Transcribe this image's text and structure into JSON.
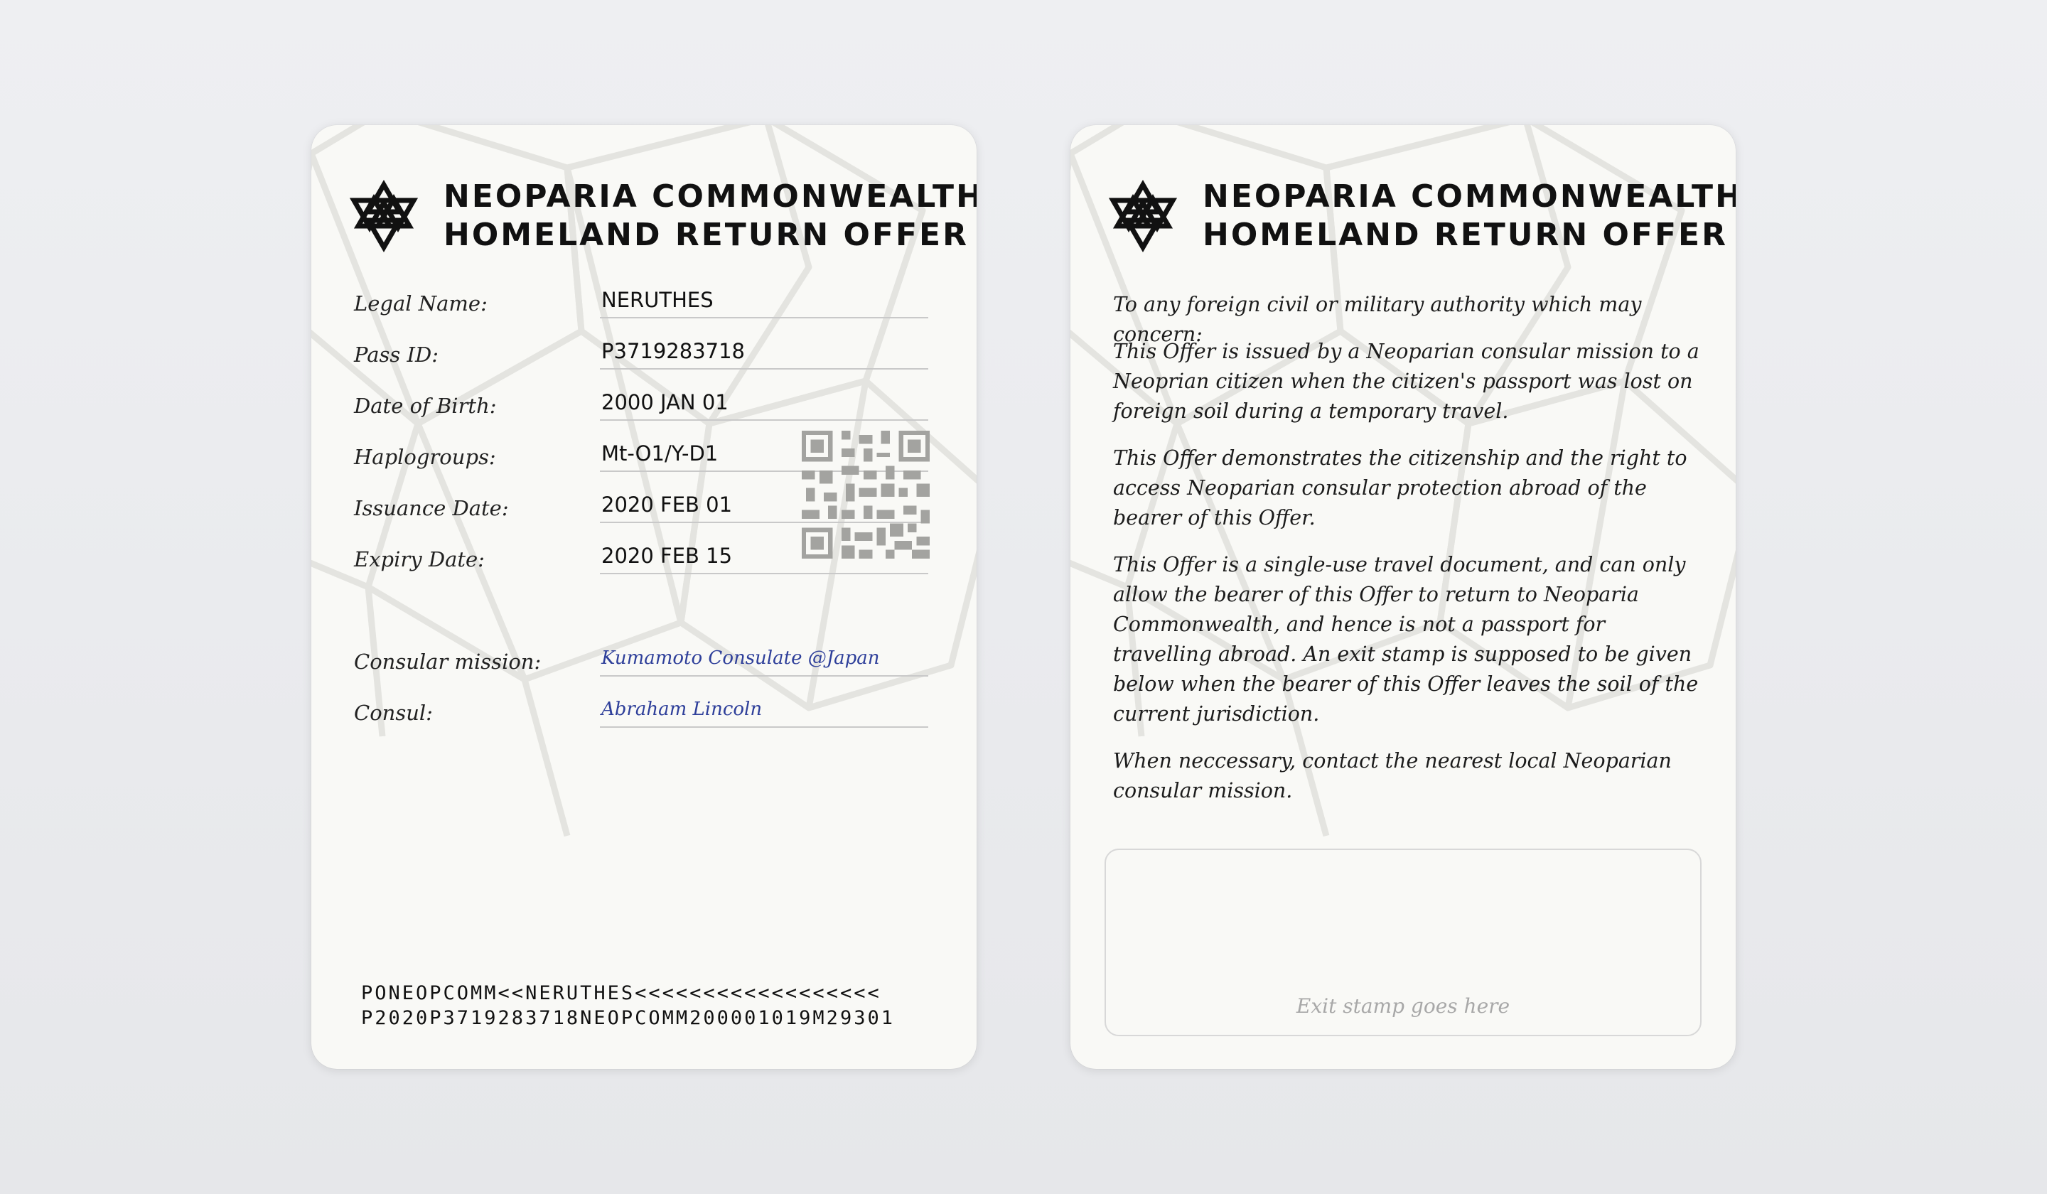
{
  "document": {
    "title_line1": "NEOPARIA COMMONWEALTH",
    "title_line2": "HOMELAND RETURN OFFER",
    "emblem_icon": "nine-pointed-star-icon",
    "colors": {
      "card": "#f9f9f6",
      "ink": "#111111",
      "handwriting": "#2e3f9a",
      "pattern": "#e3e3df"
    }
  },
  "front": {
    "fields": [
      {
        "label": "Legal Name:",
        "value": "NERUTHES"
      },
      {
        "label": "Pass ID:",
        "value": "P3719283718"
      },
      {
        "label": "Date of Birth:",
        "value": "2000 JAN 01"
      },
      {
        "label": "Haplogroups:",
        "value": "Mt-O1/Y-D1"
      },
      {
        "label": "Issuance Date:",
        "value": "2020 FEB 01"
      },
      {
        "label": "Expiry Date:",
        "value": "2020 FEB 15"
      }
    ],
    "signatures": [
      {
        "label": "Consular mission:",
        "value": "Kumamoto Consulate @Japan"
      },
      {
        "label": "Consul:",
        "value": "Abraham Lincoln"
      }
    ],
    "mrz": [
      "PONEOPCOMM<<NERUTHES<<<<<<<<<<<<<<<<<<",
      "P2020P3719283718NEOPCOMM200001019M29301"
    ]
  },
  "back": {
    "paragraphs": [
      "To any foreign civil or military authority which may concern:",
      "This Offer is issued by a Neoparian consular mission to a Neoprian citizen when the citizen's passport was lost on foreign soil during a temporary travel.",
      "This Offer demonstrates the citizenship and the right to access Neoparian consular protection abroad of the bearer of this Offer.",
      "This Offer is a single-use travel document, and can only allow the bearer of this Offer to return to Neoparia Commonwealth, and hence is not a passport for travelling abroad. An exit stamp is supposed to be given below when the bearer of this Offer leaves the soil of the current jurisdiction.",
      "When neccessary, contact the nearest local Neoparian consular mission."
    ],
    "stamp_placeholder": "Exit stamp goes here"
  }
}
